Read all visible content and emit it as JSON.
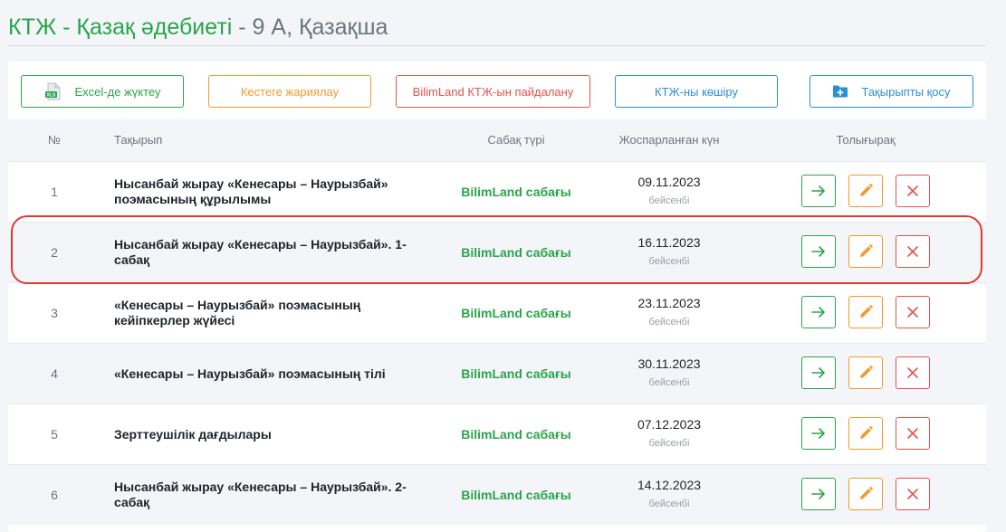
{
  "page": {
    "title_green": "КТЖ - Қазақ әдебиеті",
    "title_grey": " - 9 А, Қазақша"
  },
  "toolbar": {
    "excel_label": "Excel-де жүктеу",
    "publish_label": "Кестеге жариялау",
    "bilimland_label": "BilimLand КТЖ-ын пайдалану",
    "copy_label": "КТЖ-ны көшіру",
    "add_topic_label": "Тақырыпты қосу"
  },
  "table": {
    "headers": {
      "num": "№",
      "topic": "Тақырып",
      "type": "Сабақ түрі",
      "date": "Жоспарланған күн",
      "more": "Толығырақ"
    },
    "rows": [
      {
        "num": "1",
        "topic": "Нысанбай жырау «Кенесары – Наурызбай» поэмасының құрылымы",
        "type": "BilimLand сабағы",
        "date": "09.11.2023",
        "weekday": "бейсенбі"
      },
      {
        "num": "2",
        "topic": "Нысанбай жырау «Кенесары – Наурызбай». 1-сабақ",
        "type": "BilimLand сабағы",
        "date": "16.11.2023",
        "weekday": "бейсенбі"
      },
      {
        "num": "3",
        "topic": "«Кенесары – Наурызбай» поэмасының кейіпкерлер жүйесі",
        "type": "BilimLand сабағы",
        "date": "23.11.2023",
        "weekday": "бейсенбі"
      },
      {
        "num": "4",
        "topic": "«Кенесары – Наурызбай» поэмасының тілі",
        "type": "BilimLand сабағы",
        "date": "30.11.2023",
        "weekday": "бейсенбі"
      },
      {
        "num": "5",
        "topic": "Зерттеушілік дағдылары",
        "type": "BilimLand сабағы",
        "date": "07.12.2023",
        "weekday": "бейсенбі"
      },
      {
        "num": "6",
        "topic": "Нысанбай жырау «Кенесары – Наурызбай». 2-сабақ",
        "type": "BilimLand сабағы",
        "date": "14.12.2023",
        "weekday": "бейсенбі"
      }
    ],
    "highlighted_row": "2"
  },
  "colors": {
    "green": "#2aa54b",
    "orange": "#f39a2b",
    "red": "#e5534b",
    "blue": "#2a8fd7",
    "highlight": "#e03a30"
  },
  "icons": {
    "excel": "excel-file-icon",
    "add_topic": "folder-plus-icon",
    "go": "arrow-right-icon",
    "edit": "pencil-icon",
    "delete": "close-icon"
  }
}
